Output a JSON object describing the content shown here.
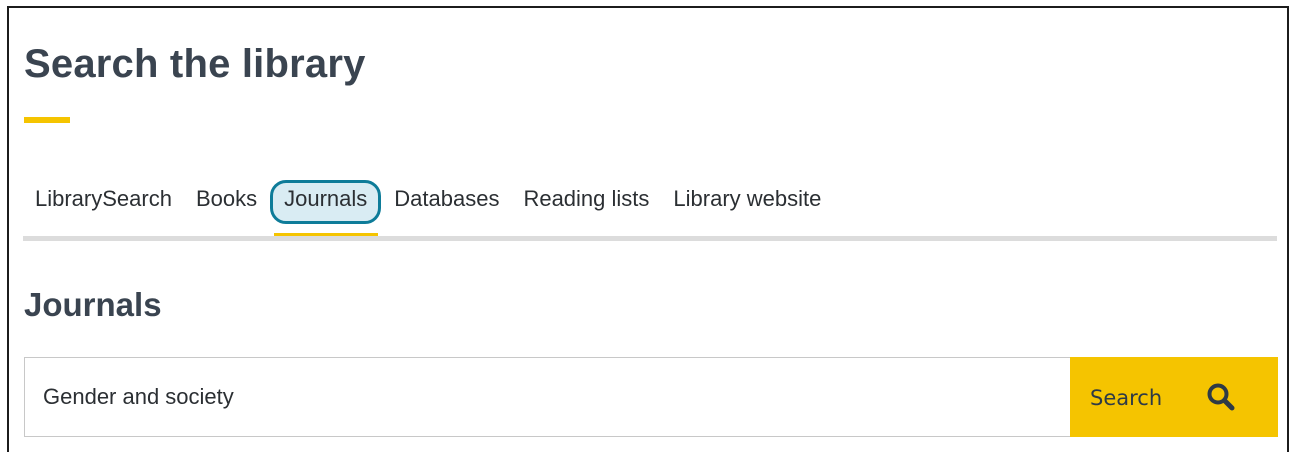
{
  "header": {
    "title": "Search the library"
  },
  "tabs": [
    {
      "label": "LibrarySearch",
      "active": false
    },
    {
      "label": "Books",
      "active": false
    },
    {
      "label": "Journals",
      "active": true
    },
    {
      "label": "Databases",
      "active": false
    },
    {
      "label": "Reading lists",
      "active": false
    },
    {
      "label": "Library website",
      "active": false
    }
  ],
  "section": {
    "heading": "Journals"
  },
  "search": {
    "value": "Gender and society",
    "button_label": "Search",
    "icon": "search-icon"
  },
  "colors": {
    "accent": "#f5c400",
    "active_tab_border": "#0e7c99",
    "active_tab_bg": "#d9ecf3",
    "heading_text": "#3a4450",
    "tab_rule": "#dcdcdc"
  }
}
